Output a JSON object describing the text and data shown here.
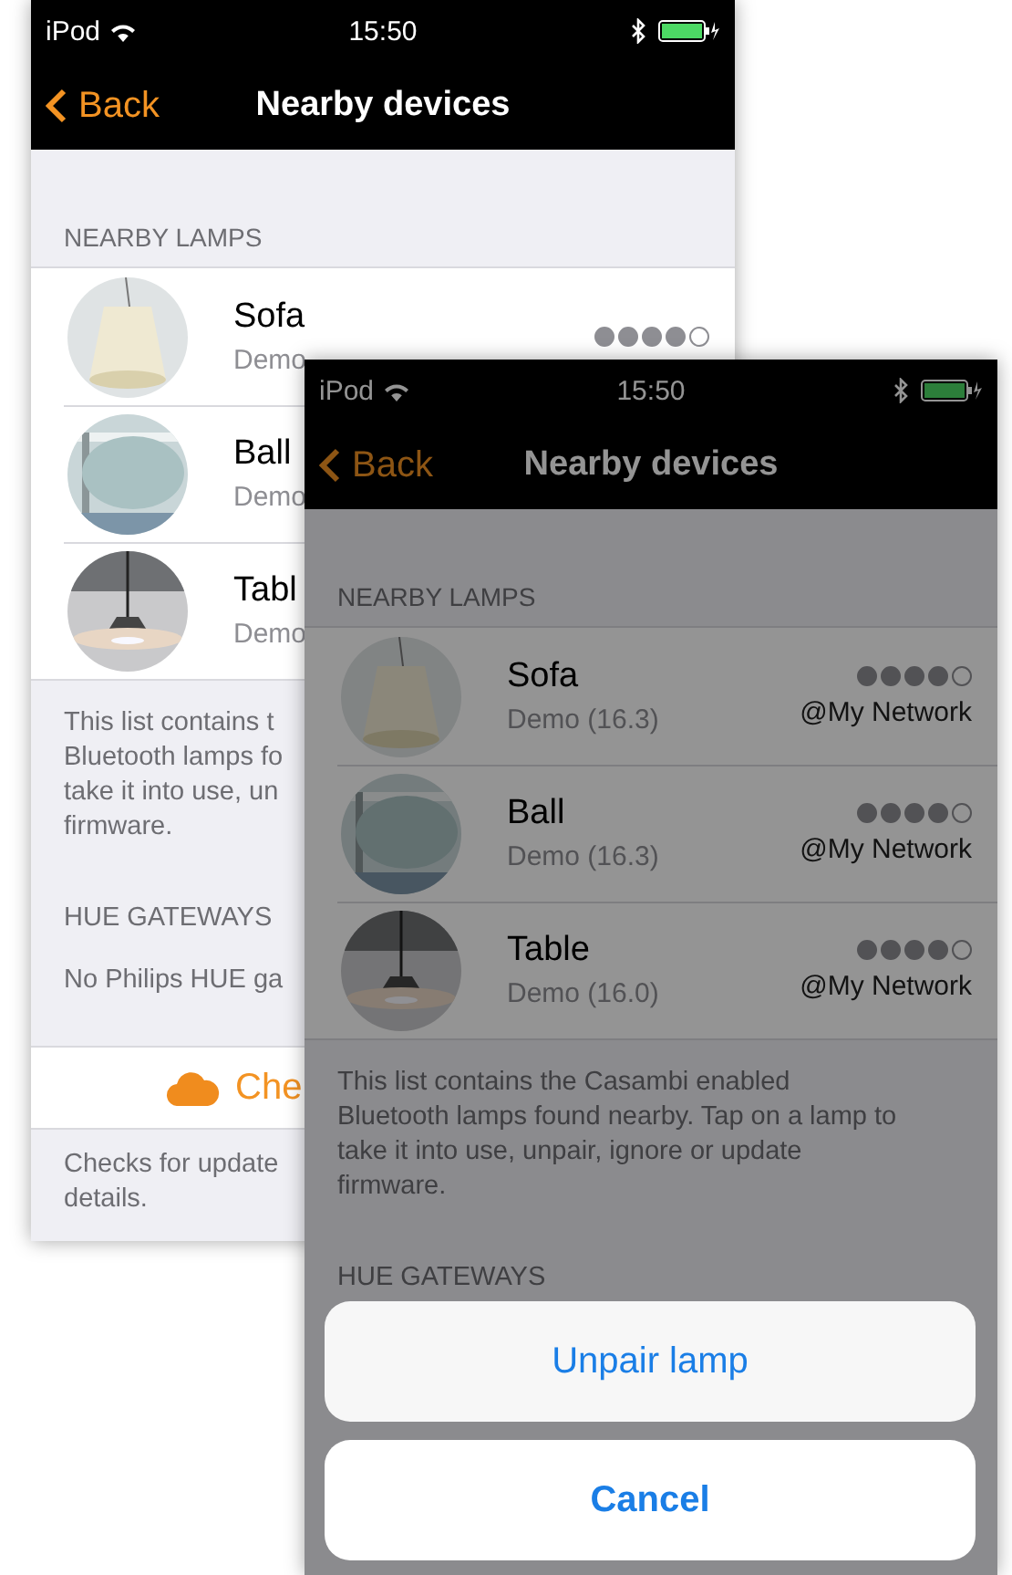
{
  "back_screen": {
    "dimmed": false,
    "status_bar": {
      "carrier": "iPod",
      "time": "15:50"
    },
    "nav_bar": {
      "back": "Back",
      "title": "Nearby devices"
    },
    "section_header": "NEARBY LAMPS",
    "lamps": [
      {
        "name": "Sofa",
        "detail": "Demo",
        "stars": 4
      },
      {
        "name": "Ball",
        "detail": "Demo"
      },
      {
        "name": "Tabl",
        "detail": "Demo"
      }
    ],
    "description": [
      "This list contains t",
      "Bluetooth lamps fo",
      "take it into use, un",
      "firmware."
    ],
    "hue_header": "HUE GATEWAYS",
    "hue_message": "No Philips HUE ga",
    "check_button": "Che",
    "footer": [
      "Checks for update",
      "details."
    ]
  },
  "front_screen": {
    "dimmed": true,
    "status_bar": {
      "carrier": "iPod",
      "time": "15:50"
    },
    "nav_bar": {
      "back": "Back",
      "title": "Nearby devices"
    },
    "section_header": "NEARBY LAMPS",
    "lamps": [
      {
        "name": "Sofa",
        "detail": "Demo (16.3)",
        "stars": 4,
        "network": "@My Network"
      },
      {
        "name": "Ball",
        "detail": "Demo (16.3)",
        "stars": 4,
        "network": "@My Network"
      },
      {
        "name": "Table",
        "detail": "Demo (16.0)",
        "stars": 4,
        "network": "@My Network"
      }
    ],
    "description": [
      "This list contains the Casambi enabled",
      "Bluetooth lamps found nearby. Tap on a lamp to",
      "take it into use, unpair, ignore or update",
      "firmware."
    ],
    "hue_header": "HUE GATEWAYS",
    "action_sheet": {
      "actions": [
        "Unpair lamp"
      ],
      "cancel": "Cancel"
    }
  }
}
